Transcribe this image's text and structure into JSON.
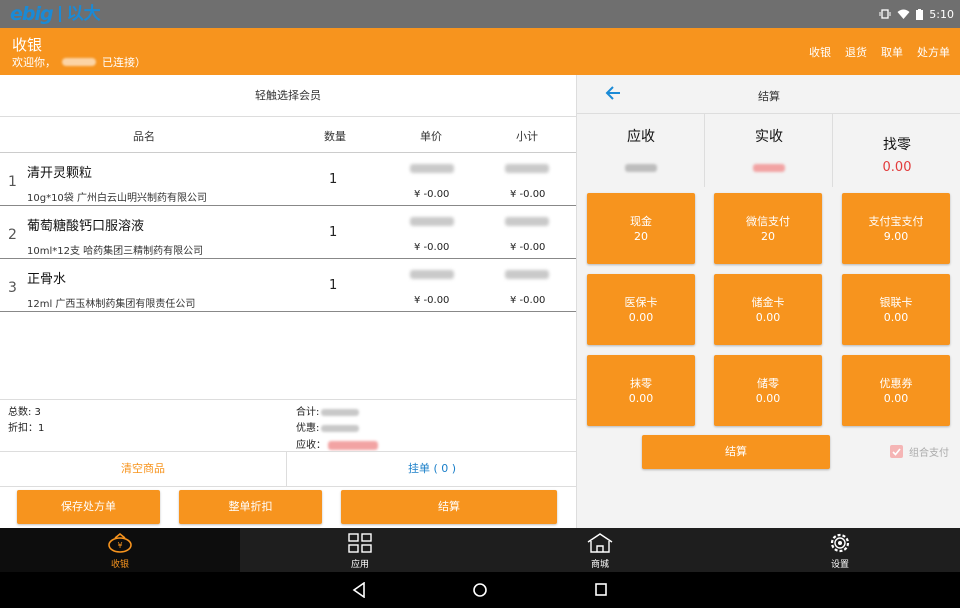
{
  "statusbar": {
    "logo_ebig": "ebig",
    "logo_cn": "以大",
    "time": "5:10"
  },
  "header": {
    "title": "收银",
    "welcome": "欢迎你，",
    "connected": "已连接）",
    "nav": [
      "收银",
      "退货",
      "取单",
      "处方单"
    ]
  },
  "cart": {
    "member_prompt": "轻触选择会员",
    "columns": {
      "name": "品名",
      "qty": "数量",
      "price": "单价",
      "subtotal": "小计"
    },
    "items": [
      {
        "index": "1",
        "name": "清开灵颗粒",
        "spec": "10g*10袋 广州白云山明兴制药有限公司",
        "qty": "1",
        "discount": "¥ -0.00",
        "sub_discount": "¥ -0.00"
      },
      {
        "index": "2",
        "name": "葡萄糖酸钙口服溶液",
        "spec": "10ml*12支 哈药集团三精制药有限公司",
        "qty": "1",
        "discount": "¥ -0.00",
        "sub_discount": "¥ -0.00"
      },
      {
        "index": "3",
        "name": "正骨水",
        "spec": "12ml 广西玉林制药集团有限责任公司",
        "qty": "1",
        "discount": "¥ -0.00",
        "sub_discount": "¥ -0.00"
      }
    ],
    "summary": {
      "total_count": "总数: 3",
      "discount": "折扣：1",
      "sum_label": "合计:",
      "promo_label": "优惠:",
      "due_label": "应收："
    },
    "clear_label": "清空商品",
    "hang_label": "挂单 ( 0 )",
    "buttons": {
      "save_rx": "保存处方单",
      "whole_discount": "整单折扣",
      "checkout": "结算"
    }
  },
  "settle": {
    "title": "结算",
    "receivable": "应收",
    "received": "实收",
    "change": "找零",
    "change_value": "0.00",
    "methods": [
      {
        "label": "现金",
        "value": "20"
      },
      {
        "label": "微信支付",
        "value": "20"
      },
      {
        "label": "支付宝支付",
        "value": "9.00"
      },
      {
        "label": "医保卡",
        "value": "0.00"
      },
      {
        "label": "储金卡",
        "value": "0.00"
      },
      {
        "label": "银联卡",
        "value": "0.00"
      },
      {
        "label": "抹零",
        "value": "0.00"
      },
      {
        "label": "储零",
        "value": "0.00"
      },
      {
        "label": "优惠券",
        "value": "0.00"
      }
    ],
    "settle_button": "结算",
    "combo_label": "组合支付"
  },
  "bottomnav": {
    "items": [
      "收银",
      "应用",
      "商城",
      "设置"
    ]
  },
  "colors": {
    "accent": "#f7941e",
    "link_blue": "#1a7fc9",
    "danger": "#e23b3b"
  }
}
